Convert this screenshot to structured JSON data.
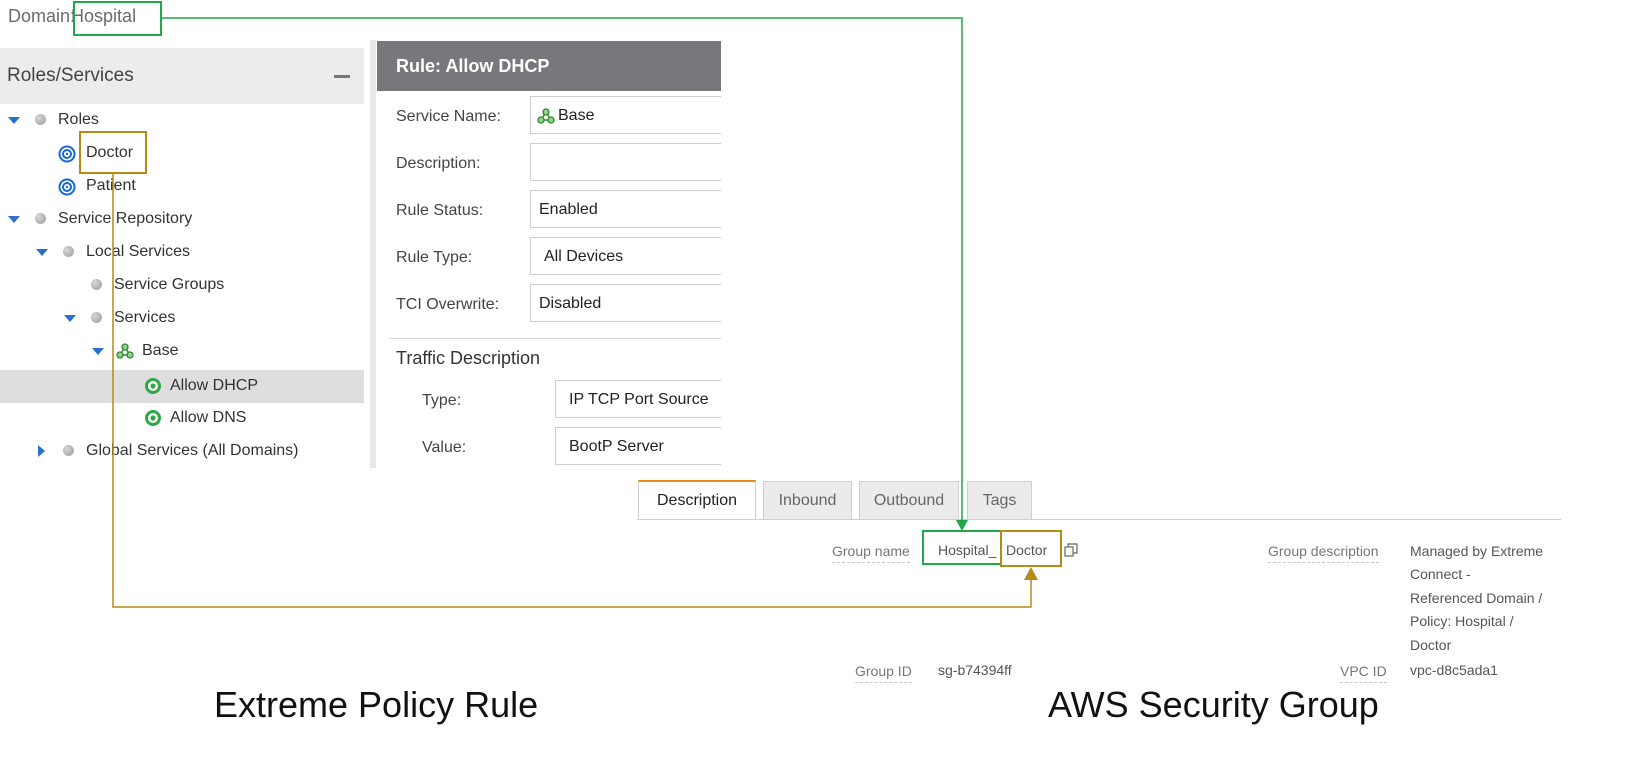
{
  "domain": {
    "label": "Domain: ",
    "value": "Hospital"
  },
  "tree": {
    "title": "Roles/Services",
    "collapse_icon": "minus-icon",
    "items": [
      {
        "label": "Roles",
        "expander": "expanded",
        "icon": "dot-icon"
      },
      {
        "label": "Doctor",
        "icon": "role-icon"
      },
      {
        "label": "Patient",
        "icon": "role-icon"
      },
      {
        "label": "Service Repository",
        "expander": "expanded",
        "icon": "dot-icon"
      },
      {
        "label": "Local Services",
        "expander": "expanded",
        "icon": "dot-icon"
      },
      {
        "label": "Service Groups",
        "icon": "dot-icon"
      },
      {
        "label": "Services",
        "expander": "expanded",
        "icon": "dot-icon"
      },
      {
        "label": "Base",
        "expander": "expanded",
        "icon": "service-group-icon"
      },
      {
        "label": "Allow DHCP",
        "icon": "rule-icon",
        "selected": true
      },
      {
        "label": "Allow DNS",
        "icon": "rule-icon"
      },
      {
        "label": "Global Services (All Domains)",
        "expander": "collapsed",
        "icon": "dot-icon"
      }
    ]
  },
  "rule": {
    "title": "Rule: Allow DHCP",
    "fields": [
      {
        "label": "Service Name:",
        "value": "Base",
        "icon": "service-group-icon"
      },
      {
        "label": "Description:",
        "value": ""
      },
      {
        "label": "Rule Status:",
        "value": "Enabled"
      },
      {
        "label": "Rule Type:",
        "value": "All Devices"
      },
      {
        "label": "TCI Overwrite:",
        "value": "Disabled"
      }
    ],
    "traffic": {
      "title": "Traffic Description",
      "fields": [
        {
          "label": "Type:",
          "value": "IP TCP Port Source"
        },
        {
          "label": "Value:",
          "value": "BootP Server"
        }
      ]
    }
  },
  "aws": {
    "tabs": [
      {
        "label": "Description",
        "active": true
      },
      {
        "label": "Inbound"
      },
      {
        "label": "Outbound"
      },
      {
        "label": "Tags"
      }
    ],
    "group_name_label": "Group name",
    "group_name_part1": "Hospital_",
    "group_name_part2": "Doctor",
    "group_description_label": "Group description",
    "group_description_lines": [
      "Managed by Extreme",
      "Connect -",
      "Referenced Domain /",
      "Policy: Hospital /",
      "Doctor"
    ],
    "group_id_label": "Group ID",
    "group_id_value": "sg-b74394ff",
    "vpc_id_label": "VPC ID",
    "vpc_id_value": "vpc-d8c5ada1"
  },
  "captions": {
    "left": "Extreme Policy Rule",
    "right": "AWS Security Group"
  },
  "colors": {
    "green_highlight": "#21a84a",
    "gold_highlight": "#b68a14",
    "rule_header_bg": "#78777c",
    "tree_caret": "#2a6ecf",
    "active_tab_accent": "#e88a1a"
  }
}
